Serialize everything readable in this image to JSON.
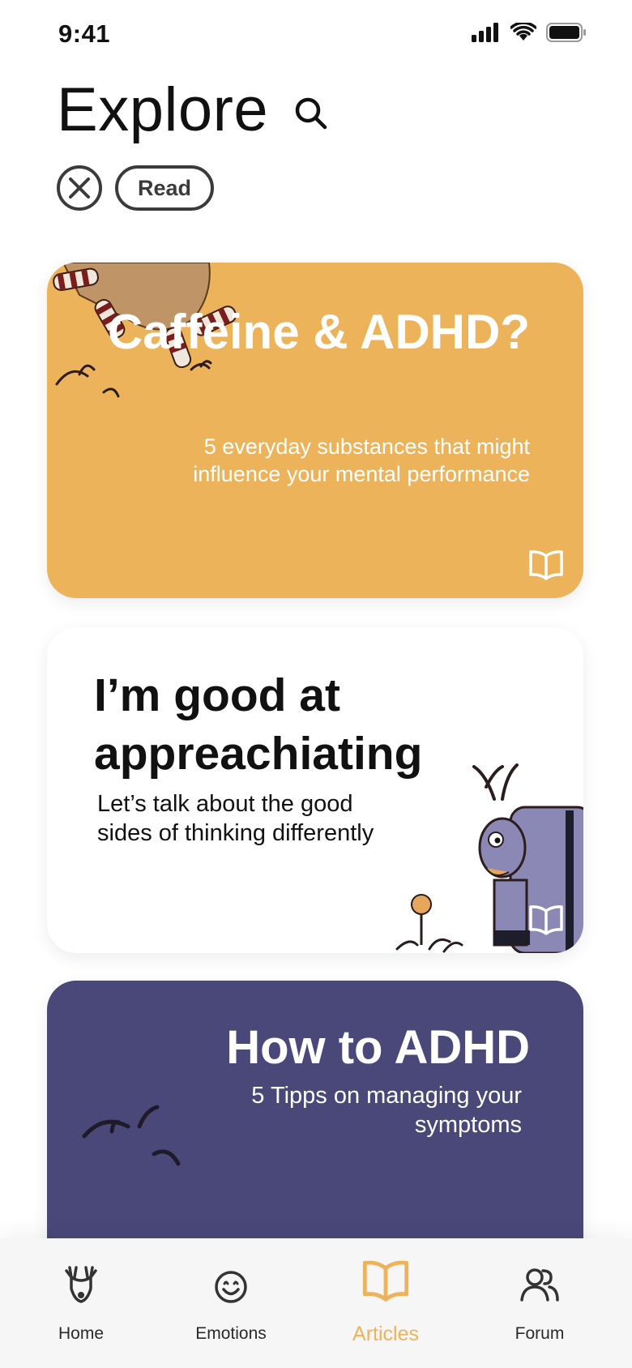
{
  "status": {
    "time": "9:41"
  },
  "header": {
    "title": "Explore"
  },
  "filters": {
    "active_chip": "Read"
  },
  "articles": [
    {
      "title": "Caffeine & ADHD?",
      "subtitle": "5 everyday substances that might influence your mental performance",
      "background": "#EDB35B",
      "type_icon": "book-open-icon"
    },
    {
      "title": "I’m good at appreachiating",
      "subtitle": "Let’s talk about the good sides of thinking differently",
      "background": "#FFFFFF",
      "type_icon": "book-open-icon"
    },
    {
      "title": "How to ADHD",
      "subtitle": "5 Tipps on managing your symptoms",
      "background": "#4A4879",
      "type_icon": "book-open-icon"
    }
  ],
  "tabbar": {
    "items": [
      {
        "label": "Home",
        "icon": "deer-icon",
        "active": false
      },
      {
        "label": "Emotions",
        "icon": "smiley-icon",
        "active": false
      },
      {
        "label": "Articles",
        "icon": "book-open-icon",
        "active": true
      },
      {
        "label": "Forum",
        "icon": "people-icon",
        "active": false
      }
    ]
  },
  "colors": {
    "accent": "#EDB35B",
    "card_purple": "#4A4879",
    "card_orange": "#EDB35B",
    "text_dark": "#111111"
  }
}
